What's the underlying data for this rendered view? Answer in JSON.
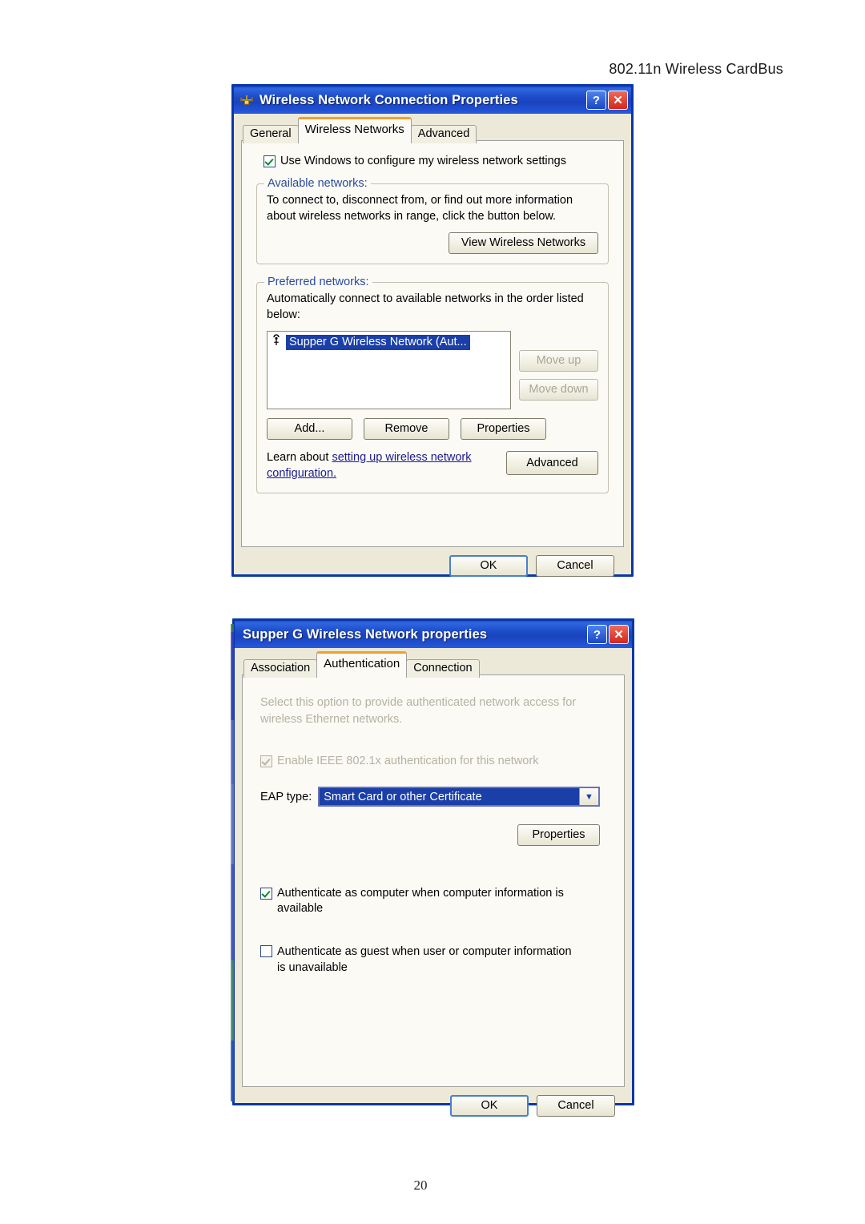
{
  "page": {
    "header": "802.11n Wireless CardBus",
    "number": "20"
  },
  "dialog1": {
    "title": "Wireless Network Connection Properties",
    "title_icon": "network-connection-icon",
    "help_button": "?",
    "close_button": "✕",
    "tabs": [
      {
        "label": "General",
        "active": false
      },
      {
        "label": "Wireless Networks",
        "active": true
      },
      {
        "label": "Advanced",
        "active": false
      }
    ],
    "use_windows_checkbox": {
      "label": "Use Windows to configure my wireless network settings",
      "checked": true
    },
    "available_networks": {
      "title": "Available networks:",
      "description": "To connect to, disconnect from, or find out more information about wireless networks in range, click the button below.",
      "button": "View Wireless Networks"
    },
    "preferred_networks": {
      "title": "Preferred networks:",
      "description": "Automatically connect to available networks in the order listed below:",
      "items": [
        {
          "label": "Supper G Wireless Network (Aut...",
          "icon": "wireless-signal-icon",
          "selected": true
        }
      ],
      "move_up": "Move up",
      "move_down": "Move down",
      "add": "Add...",
      "remove": "Remove",
      "properties": "Properties",
      "learn_prefix": "Learn about ",
      "learn_link_1": "setting up wireless network",
      "learn_link_2": "configuration.",
      "advanced": "Advanced"
    },
    "footer": {
      "ok": "OK",
      "cancel": "Cancel"
    }
  },
  "dialog2": {
    "title": "Supper G Wireless Network properties",
    "help_button": "?",
    "close_button": "✕",
    "tabs": [
      {
        "label": "Association",
        "active": false
      },
      {
        "label": "Authentication",
        "active": true
      },
      {
        "label": "Connection",
        "active": false
      }
    ],
    "description": "Select this option to provide authenticated network access for wireless Ethernet networks.",
    "enable_8021x": {
      "label": "Enable IEEE 802.1x authentication for this network",
      "checked": true,
      "disabled": true
    },
    "eap": {
      "label": "EAP type:",
      "value": "Smart Card or other Certificate",
      "arrow": "▼",
      "properties_button": "Properties"
    },
    "auth_computer": {
      "label": "Authenticate as computer when computer information is available",
      "checked": true
    },
    "auth_guest": {
      "label": "Authenticate as guest when user or computer information is unavailable",
      "checked": false
    },
    "footer": {
      "ok": "OK",
      "cancel": "Cancel"
    }
  },
  "colors": {
    "titlebar_blue": "#1c49c6",
    "dialog_face": "#ece9d8",
    "tab_active_accent": "#f0a030",
    "selection_blue": "#1a3fa8",
    "group_title": "#2b4aa0",
    "link": "#1b1b8f",
    "close_red": "#d3271a"
  }
}
